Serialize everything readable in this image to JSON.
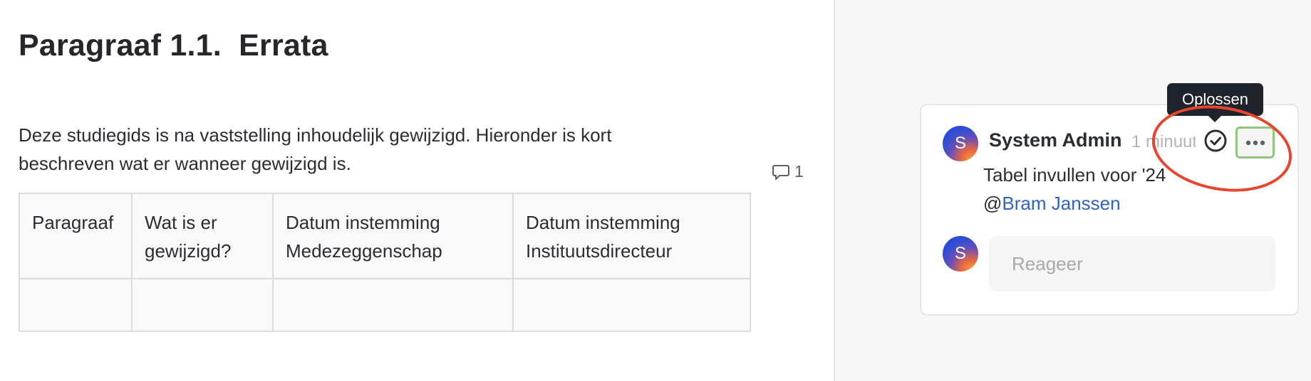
{
  "document": {
    "title": "Paragraaf 1.1.  Errata",
    "intro_line1": "Deze studiegids is na vaststelling inhoudelijk gewijzigd. Hieronder is kort",
    "intro_line2": "beschreven wat er wanneer gewijzigd is.",
    "table": {
      "headers": [
        {
          "line1": "Paragraaf",
          "line2": ""
        },
        {
          "line1": "Wat is er",
          "line2": "gewijzigd?"
        },
        {
          "line1": "Datum instemming",
          "line2": "Medezeggenschap"
        },
        {
          "line1": "Datum instemming",
          "line2": "Instituutsdirecteur"
        }
      ],
      "rows": [
        [
          "",
          "",
          "",
          ""
        ]
      ]
    },
    "comment_indicator": {
      "icon": "speech-bubble-icon",
      "count": "1"
    }
  },
  "comments_pane": {
    "thread": {
      "author": "System Admin",
      "avatar_initial": "S",
      "timestamp": "1 minuut",
      "body_text": "Tabel invullen voor '24",
      "mention_prefix": "@",
      "mention_name": "Bram Janssen",
      "resolve_icon": "check-circle-icon",
      "more_icon": "ellipsis-icon",
      "tooltip": "Oplossen"
    },
    "reply": {
      "avatar_initial": "S",
      "placeholder": "Reageer"
    }
  },
  "colors": {
    "mention": "#2e63c6",
    "tooltip_bg": "#1f232c",
    "annotation_circle": "#e8452e",
    "more_button_border": "#93c47d",
    "pane_background": "#f7f7f7"
  }
}
